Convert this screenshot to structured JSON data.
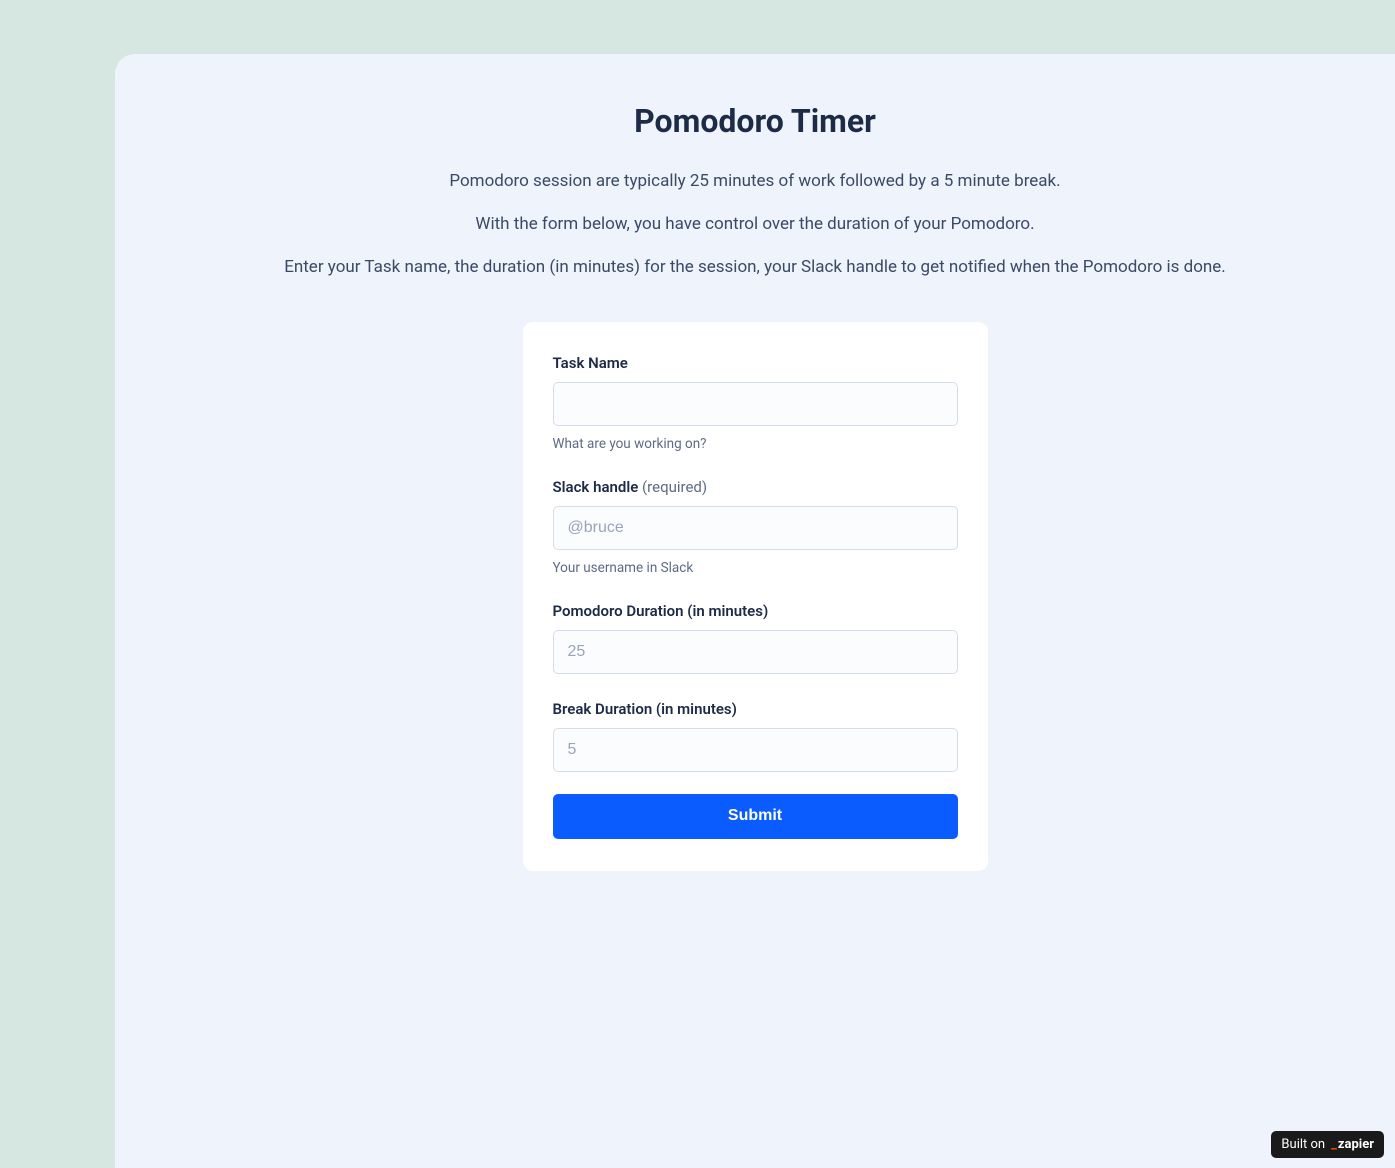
{
  "page": {
    "title": "Pomodoro Timer",
    "description_1": "Pomodoro session are typically 25 minutes of work followed by a 5 minute break.",
    "description_2": "With the form below, you have control over the duration of your Pomodoro.",
    "description_3": "Enter your Task name, the duration (in minutes) for the session, your Slack handle to get notified when the Pomodoro is done."
  },
  "form": {
    "task_name": {
      "label": "Task Name",
      "value": "",
      "hint": "What are you working on?"
    },
    "slack_handle": {
      "label": "Slack handle",
      "required_text": "(required)",
      "placeholder": "@bruce",
      "value": "",
      "hint": "Your username in Slack"
    },
    "pomodoro_duration": {
      "label": "Pomodoro Duration (in minutes)",
      "placeholder": "25",
      "value": ""
    },
    "break_duration": {
      "label": "Break Duration (in minutes)",
      "placeholder": "5",
      "value": ""
    },
    "submit_label": "Submit"
  },
  "badge": {
    "prefix": "Built on",
    "brand": "zapier"
  }
}
